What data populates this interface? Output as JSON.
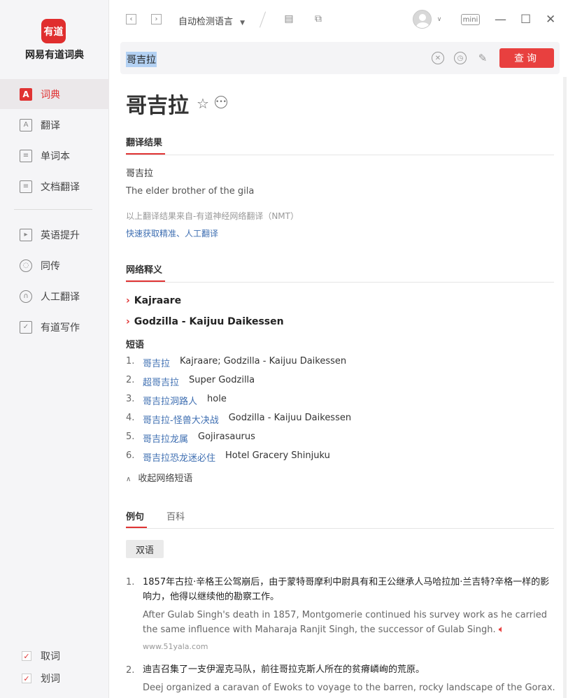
{
  "sidebar": {
    "logo_text": "有道",
    "app_name": "网易有道词典",
    "items": [
      {
        "label": "词典",
        "icon": "dictionary-icon"
      },
      {
        "label": "翻译",
        "icon": "translate-icon"
      },
      {
        "label": "单词本",
        "icon": "wordbook-icon"
      },
      {
        "label": "文档翻译",
        "icon": "document-icon"
      },
      {
        "label": "英语提升",
        "icon": "video-icon"
      },
      {
        "label": "同传",
        "icon": "cloud-icon"
      },
      {
        "label": "人工翻译",
        "icon": "headset-icon"
      },
      {
        "label": "有道写作",
        "icon": "writing-icon"
      }
    ],
    "checks": [
      {
        "label": "取词",
        "checked": true
      },
      {
        "label": "划词",
        "checked": true
      }
    ]
  },
  "topbar": {
    "language": "自动检测语言",
    "mini_label": "mini"
  },
  "search": {
    "query": "哥吉拉",
    "button_label": "查询"
  },
  "entry": {
    "headword": "哥吉拉",
    "translation_section": "翻译结果",
    "translation_source_word": "哥吉拉",
    "translation_text": "The elder brother of the gila",
    "translation_note": "以上翻译结果来自-有道神经网络翻译（NMT）",
    "translation_link": "快速获取精准、人工翻译",
    "web_section": "网络释义",
    "web_items": [
      "Kajraare",
      "Godzilla - Kaijuu Daikessen"
    ],
    "phrases_title": "短语",
    "phrases": [
      {
        "num": "1.",
        "term": "哥吉拉",
        "meaning": "Kajraare;  Godzilla - Kaijuu Daikessen"
      },
      {
        "num": "2.",
        "term": "超哥吉拉",
        "meaning": "Super Godzilla"
      },
      {
        "num": "3.",
        "term": "哥吉拉洞路人",
        "meaning": "hole"
      },
      {
        "num": "4.",
        "term": "哥吉拉-怪兽大决战",
        "meaning": "Godzilla - Kaijuu Daikessen"
      },
      {
        "num": "5.",
        "term": "哥吉拉龙属",
        "meaning": "Gojirasaurus"
      },
      {
        "num": "6.",
        "term": "哥吉拉恐龙迷必住",
        "meaning": "Hotel Gracery Shinjuku"
      }
    ],
    "collapse_label": "收起网络短语",
    "tabs": [
      "例句",
      "百科"
    ],
    "bilingual_label": "双语",
    "examples": [
      {
        "num": "1.",
        "cn": "1857年古拉·辛格王公驾崩后，由于蒙特哥摩利中尉具有和王公继承人马哈拉加·兰吉特?辛格一样的影响力，他得以继续他的勘察工作。",
        "en": "After Gulab Singh's death in 1857, Montgomerie continued his survey work as he carried the same influence with Maharaja Ranjit Singh, the successor of Gulab Singh.",
        "source": "www.51yala.com"
      },
      {
        "num": "2.",
        "cn": "迪吉召集了一支伊渥克马队，前往哥拉克斯人所在的贫瘠嶙峋的荒原。",
        "en": "Deej organized a caravan of Ewoks to voyage to the barren, rocky landscape of the Gorax."
      }
    ]
  }
}
